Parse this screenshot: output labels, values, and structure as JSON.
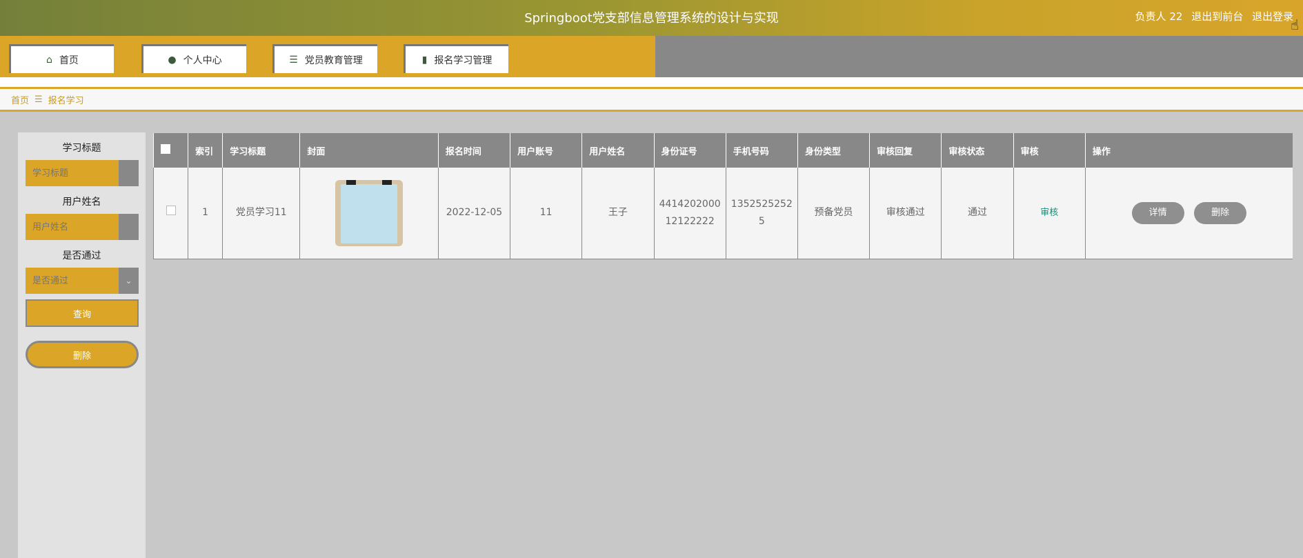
{
  "header": {
    "title": "Springboot党支部信息管理系统的设计与实现",
    "user_label": "负责人 22",
    "front_link": "退出到前台",
    "logout_link": "退出登录"
  },
  "nav": {
    "items": [
      {
        "label": "首页",
        "icon": "home-icon"
      },
      {
        "label": "个人中心",
        "icon": "user-icon"
      },
      {
        "label": "党员教育管理",
        "icon": "list-icon"
      },
      {
        "label": "报名学习管理",
        "icon": "book-icon"
      }
    ]
  },
  "breadcrumb": {
    "home": "首页",
    "separator": "☰",
    "current": "报名学习"
  },
  "search": {
    "title_label": "学习标题",
    "title_placeholder": "学习标题",
    "name_label": "用户姓名",
    "name_placeholder": "用户姓名",
    "pass_label": "是否通过",
    "pass_placeholder": "是否通过",
    "query_button": "查询",
    "delete_button": "删除"
  },
  "table": {
    "headers": [
      "索引",
      "学习标题",
      "封面",
      "报名时间",
      "用户账号",
      "用户姓名",
      "身份证号",
      "手机号码",
      "身份类型",
      "审核回复",
      "审核状态",
      "审核",
      "操作"
    ],
    "rows": [
      {
        "index": "1",
        "title": "党员学习11",
        "time": "2022-12-05",
        "account": "11",
        "name": "王子",
        "id_line1": "4414202000",
        "id_line2": "12122222",
        "phone_line1": "1352525252",
        "phone_line2": "5",
        "identity": "预备党员",
        "reply": "审核通过",
        "status": "通过",
        "audit": "审核",
        "detail_button": "详情",
        "delete_button": "删除"
      }
    ]
  },
  "colors": {
    "gold": "#dba627",
    "gray": "#888888",
    "audit_link": "#1a8a78"
  }
}
